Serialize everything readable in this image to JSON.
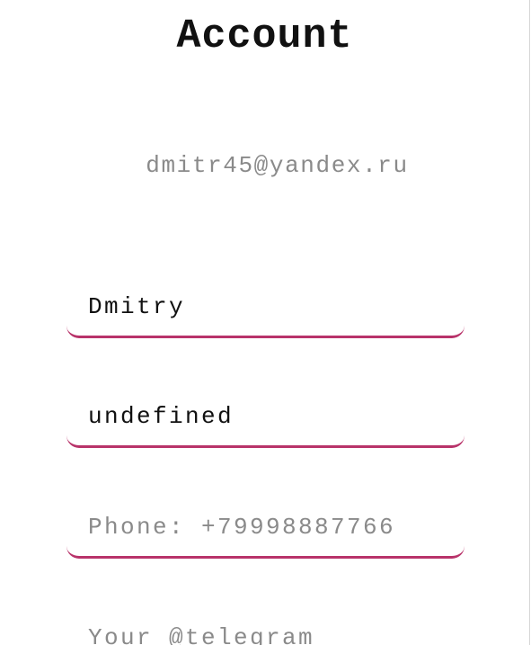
{
  "page": {
    "title": "Account",
    "email": "dmitr45@yandex.ru"
  },
  "form": {
    "name": {
      "value": "Dmitry",
      "placeholder": ""
    },
    "surname": {
      "value": "undefined",
      "placeholder": ""
    },
    "phone": {
      "value": "",
      "placeholder": "Phone: +79998887766"
    },
    "telegram": {
      "value": "",
      "placeholder": "Your @telegram"
    }
  },
  "colors": {
    "accent_underline": "#b8336a",
    "text": "#111111",
    "muted_text": "#8a8a8a",
    "background": "#ffffff"
  }
}
